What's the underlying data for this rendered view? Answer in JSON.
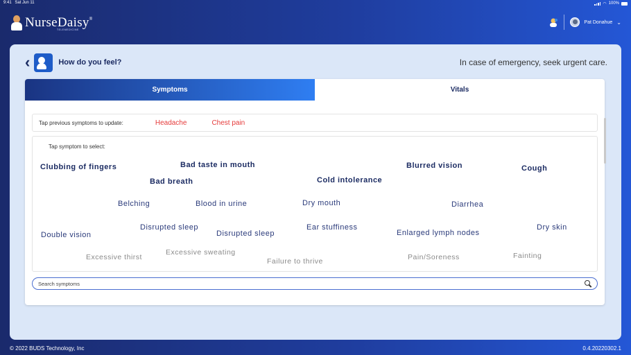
{
  "status_bar": {
    "time": "9:41",
    "date": "Sat Jun 11",
    "battery": "100%"
  },
  "app": {
    "brand": "NurseDaisy",
    "brand_mark": "®",
    "brand_sub": "TELEMEDICINE"
  },
  "user": {
    "name": "Pat Donahue"
  },
  "header": {
    "title": "How do you feel?",
    "notice": "In case of emergency, seek urgent care."
  },
  "tabs": [
    {
      "label": "Symptoms",
      "active": true
    },
    {
      "label": "Vitals",
      "active": false
    }
  ],
  "previous": {
    "label": "Tap previous symptoms to update:",
    "items": [
      "Headache",
      "Chest pain"
    ]
  },
  "symptoms": {
    "label": "Tap symptom to select:",
    "items": [
      "Clubbing of fingers",
      "Bad taste in mouth",
      "Blurred vision",
      "Cough",
      "Bad breath",
      "Cold intolerance",
      "Belching",
      "Blood in urine",
      "Dry mouth",
      "Diarrhea",
      "Double vision",
      "Disrupted sleep",
      "Disrupted sleep",
      "Ear stuffiness",
      "Enlarged lymph nodes",
      "Dry skin",
      "Excessive thirst",
      "Excessive sweating",
      "Failure to thrive",
      "Pain/Soreness",
      "Fainting"
    ]
  },
  "search": {
    "placeholder": "Search symptoms"
  },
  "footer": {
    "copyright": "© 2022 BUDS Technology, Inc",
    "version": "0.4.20220302.1"
  },
  "colors": {
    "accent": "#1e5cc8",
    "previous_symptom": "#e53a3a",
    "panel": "#dbe7f8"
  }
}
